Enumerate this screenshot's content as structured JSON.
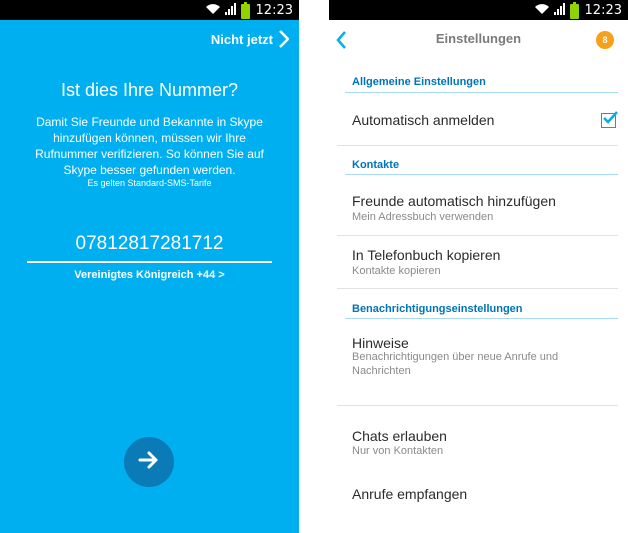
{
  "status_bar": {
    "time": "12:23"
  },
  "left": {
    "skip_label": "Nicht jetzt",
    "title": "Ist dies Ihre Nummer?",
    "description": "Damit Sie Freunde und Bekannte in Skype hinzufügen können, müssen wir Ihre Rufnummer verifizieren. So können Sie auf Skype besser gefunden werden.",
    "sms_note": "Es gelten Standard-SMS-Tarife",
    "phone_number": "07812817281712",
    "country_selector": "Vereinigtes Königreich +44 >"
  },
  "right": {
    "toolbar": {
      "title": "Einstellungen",
      "badge_count": "8"
    },
    "sections": {
      "general": "Allgemeine Einstellungen",
      "contacts": "Kontakte",
      "notifications": "Benachrichtigungseinstellungen"
    },
    "items": {
      "auto_login": {
        "title": "Automatisch anmelden",
        "checked": true
      },
      "add_friends": {
        "title": "Freunde automatisch hinzufügen",
        "subtitle": "Mein Adressbuch verwenden"
      },
      "copy_phonebook": {
        "title": "In Telefonbuch kopieren",
        "subtitle": "Kontakte kopieren"
      },
      "hints": {
        "title": "Hinweise",
        "subtitle": "Benachrichtigungen über neue Anrufe und Nachrichten"
      },
      "allow_chats": {
        "title": "Chats erlauben",
        "subtitle": "Nur von Kontakten"
      },
      "receive_calls": {
        "title": "Anrufe empfangen"
      }
    }
  },
  "colors": {
    "skype_blue": "#00aff0",
    "button_blue": "#0a7bb6",
    "section_blue": "#0074b8",
    "badge_orange": "#f7a01b"
  }
}
